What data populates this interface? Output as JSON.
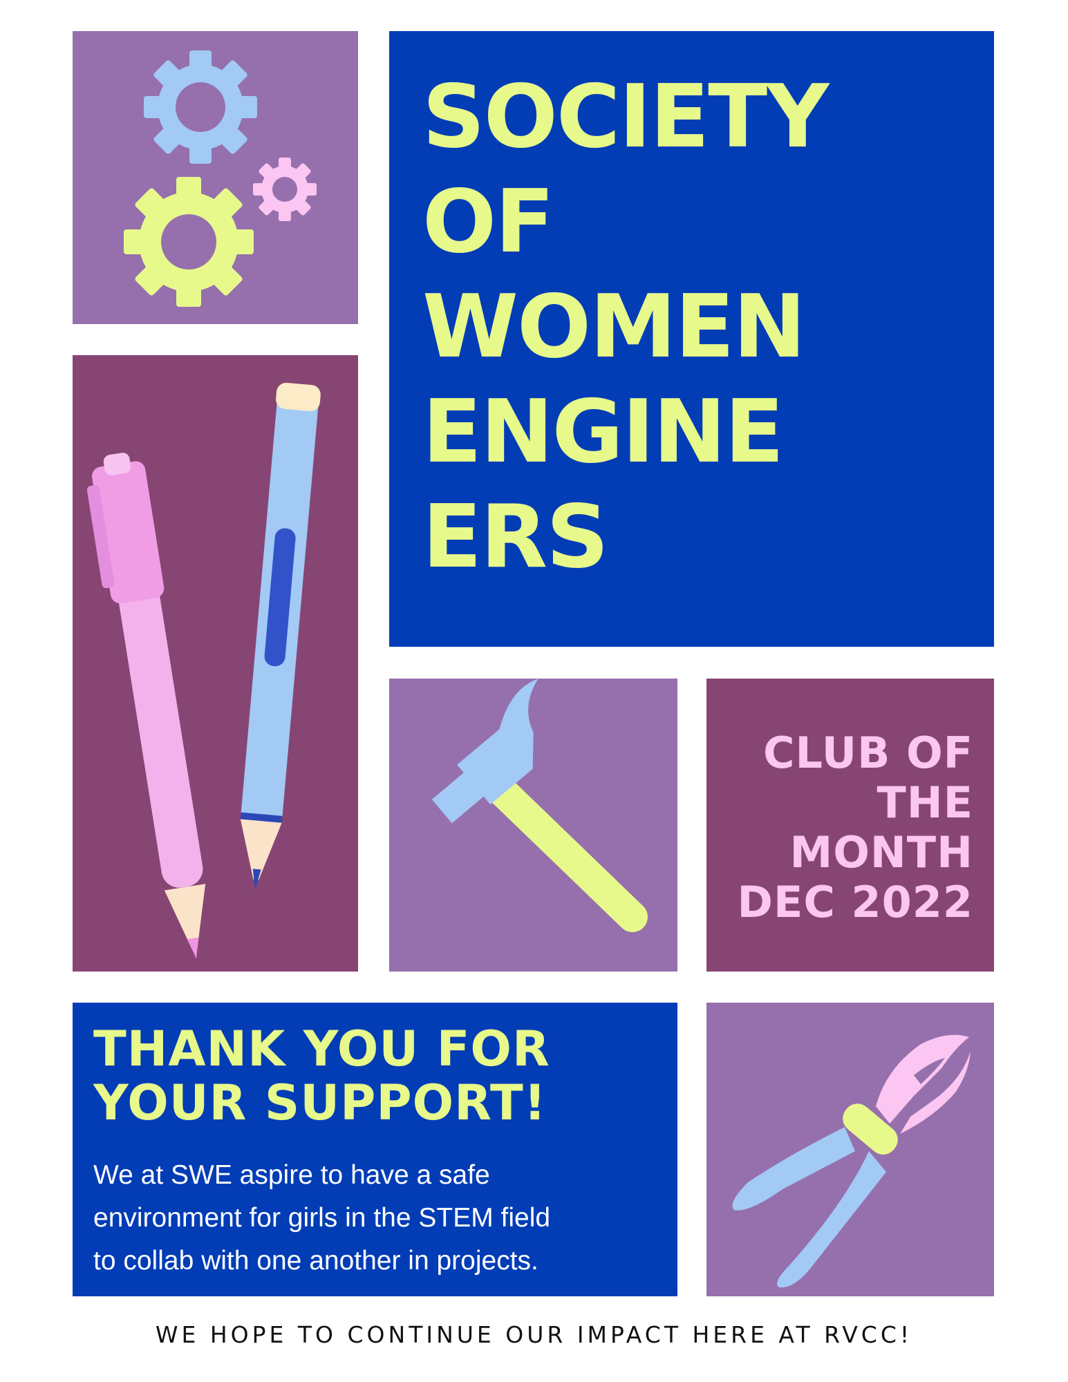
{
  "title": {
    "lines": [
      "SOCIETY",
      "OF",
      "WOMEN",
      "ENGINE",
      "ERS"
    ]
  },
  "club_panel": {
    "lines": [
      "CLUB OF",
      "THE",
      "MONTH",
      "DEC 2022"
    ]
  },
  "thanks_panel": {
    "heading_lines": [
      "THANK YOU FOR",
      "YOUR SUPPORT!"
    ],
    "body_lines": [
      "We at SWE aspire to have a safe",
      "environment for girls in the STEM field",
      "to collab with one another in projects."
    ]
  },
  "footer": {
    "text": "WE HOPE TO CONTINUE OUR IMPACT HERE AT RVCC!"
  },
  "icons": {
    "gears": "gears-icon",
    "pen": "pen-icon",
    "pencil": "pencil-icon",
    "hammer": "hammer-icon",
    "pliers": "pliers-icon"
  },
  "colors": {
    "lavender": "#9570ad",
    "plum": "#874574",
    "royal_blue": "#023db6",
    "lime": "#e8f98b",
    "pink": "#fbc6f1",
    "light_blue": "#a3c9f5"
  }
}
